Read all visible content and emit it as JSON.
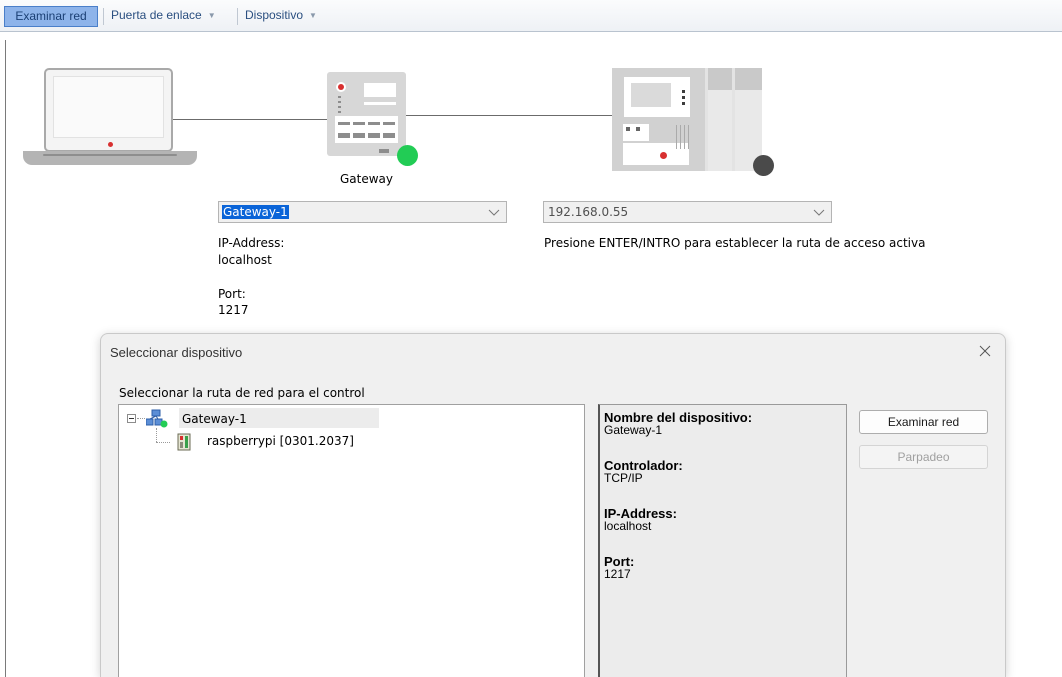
{
  "toolbar": {
    "scan_label": "Examinar red",
    "gateway_menu": "Puerta de enlace",
    "device_menu": "Dispositivo"
  },
  "topology": {
    "gateway_label": "Gateway",
    "gateway_status_color": "#22cc55",
    "device_status_color": "#4a4a4a",
    "gateway_combo": {
      "value": "Gateway-1"
    },
    "device_combo": {
      "value": "192.168.0.55"
    },
    "gateway_info": {
      "ip_label": "IP-Address:",
      "ip_value": "localhost",
      "port_label": "Port:",
      "port_value": "1217"
    },
    "device_hint": "Presione ENTER/INTRO para establecer la ruta de acceso activa"
  },
  "dialog": {
    "title": "Seleccionar dispositivo",
    "caption": "Seleccionar la ruta de red para el control",
    "tree": [
      {
        "label": "Gateway-1",
        "icon": "network-gateway-icon",
        "expanded": true
      },
      {
        "label": "raspberrypi [0301.2037]",
        "icon": "plc-device-icon"
      }
    ],
    "properties": [
      {
        "key": "Nombre del dispositivo:",
        "value": "Gateway-1"
      },
      {
        "key": "Controlador:",
        "value": "TCP/IP"
      },
      {
        "key": "IP-Address:",
        "value": "localhost"
      },
      {
        "key": "Port:",
        "value": "1217"
      }
    ],
    "buttons": {
      "scan": "Examinar red",
      "blink": "Parpadeo"
    }
  }
}
